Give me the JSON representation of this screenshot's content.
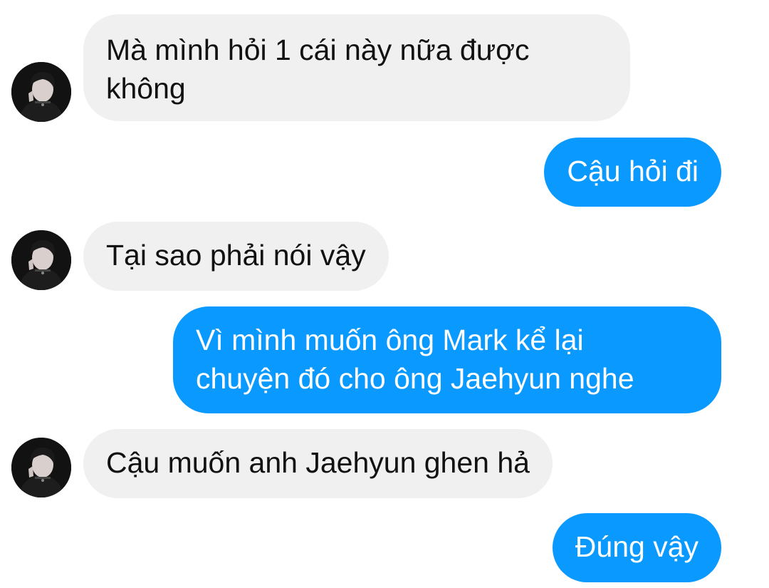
{
  "messages": [
    {
      "sender": "other",
      "lines": [
        "Mà mình hỏi 1 cái này nữa được",
        "không"
      ]
    },
    {
      "sender": "me",
      "lines": [
        "Cậu hỏi đi"
      ]
    },
    {
      "sender": "other",
      "lines": [
        "Tại sao phải nói vậy"
      ]
    },
    {
      "sender": "me",
      "lines": [
        "Vì mình muốn ông Mark kể lại",
        "chuyện đó cho ông Jaehyun nghe"
      ]
    },
    {
      "sender": "other",
      "lines": [
        "Cậu muốn anh Jaehyun ghen hả"
      ]
    },
    {
      "sender": "me",
      "lines": [
        "Đúng vậy"
      ]
    }
  ],
  "colors": {
    "incoming_bubble": "#f0f0f0",
    "outgoing_bubble": "#0a99ff",
    "incoming_text": "#111111",
    "outgoing_text": "#ffffff"
  }
}
